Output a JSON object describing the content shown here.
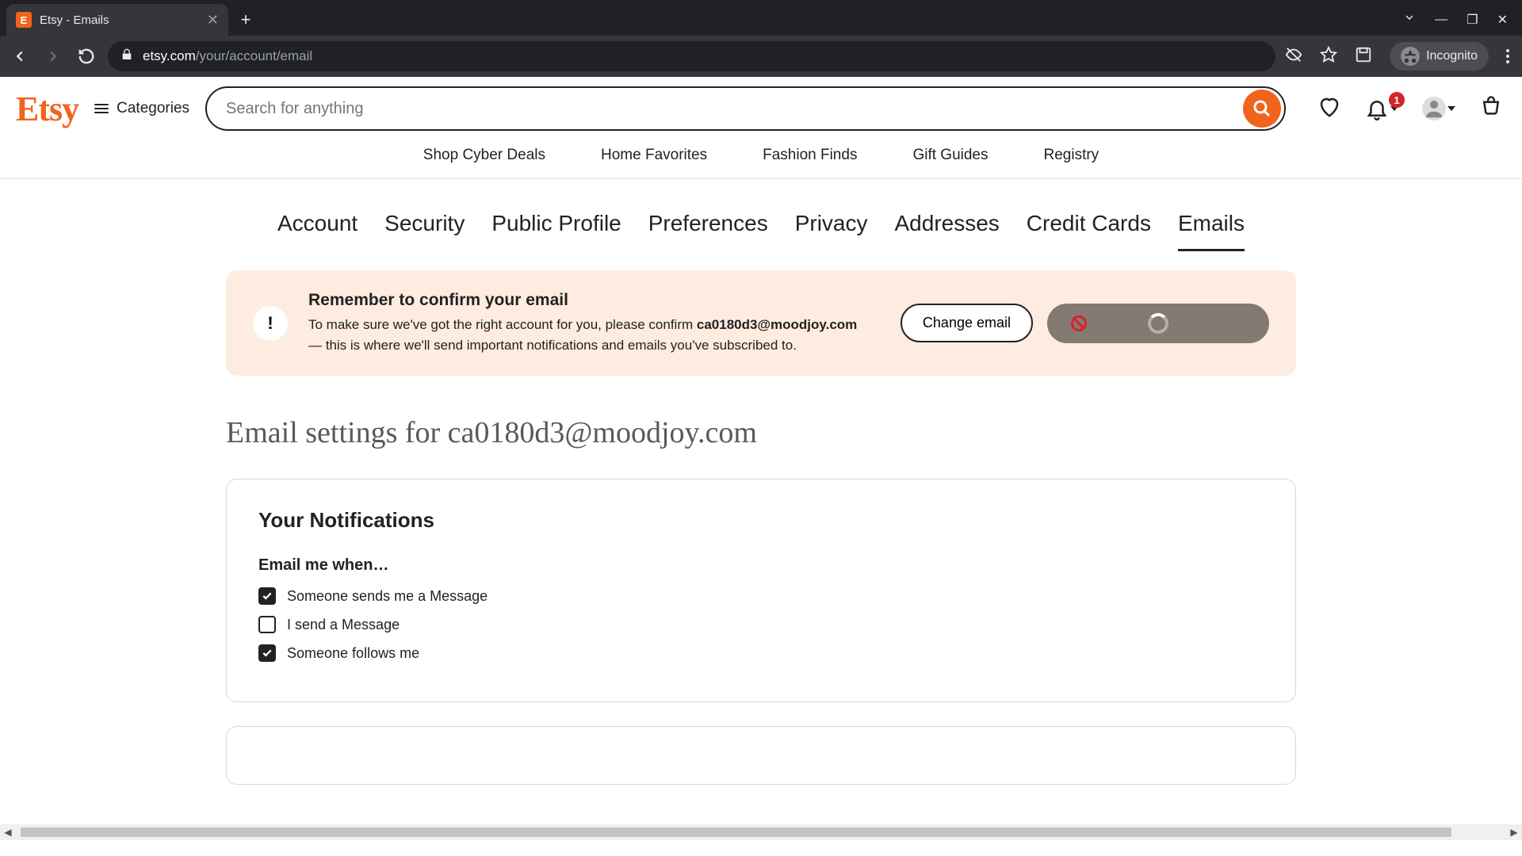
{
  "browser": {
    "tab_title": "Etsy - Emails",
    "favicon_letter": "E",
    "url_domain": "etsy.com",
    "url_path": "/your/account/email",
    "incognito_label": "Incognito"
  },
  "header": {
    "logo": "Etsy",
    "categories_label": "Categories",
    "search_placeholder": "Search for anything",
    "notif_count": "1"
  },
  "subnav": {
    "items": [
      "Shop Cyber Deals",
      "Home Favorites",
      "Fashion Finds",
      "Gift Guides",
      "Registry"
    ]
  },
  "tabs": {
    "items": [
      "Account",
      "Security",
      "Public Profile",
      "Preferences",
      "Privacy",
      "Addresses",
      "Credit Cards",
      "Emails"
    ],
    "active_index": 7
  },
  "alert": {
    "icon": "!",
    "title": "Remember to confirm your email",
    "body_prefix": "To make sure we've got the right account for you, please confirm ",
    "email": "ca0180d3@moodjoy.com",
    "body_suffix": " — this is where we'll send important notifications and emails you've subscribed to.",
    "change_label": "Change email"
  },
  "settings_heading": "Email settings for ca0180d3@moodjoy.com",
  "notifications": {
    "title": "Your Notifications",
    "subhead": "Email me when…",
    "options": [
      {
        "label": "Someone sends me a Message",
        "checked": true
      },
      {
        "label": "I send a Message",
        "checked": false
      },
      {
        "label": "Someone follows me",
        "checked": true
      }
    ]
  }
}
